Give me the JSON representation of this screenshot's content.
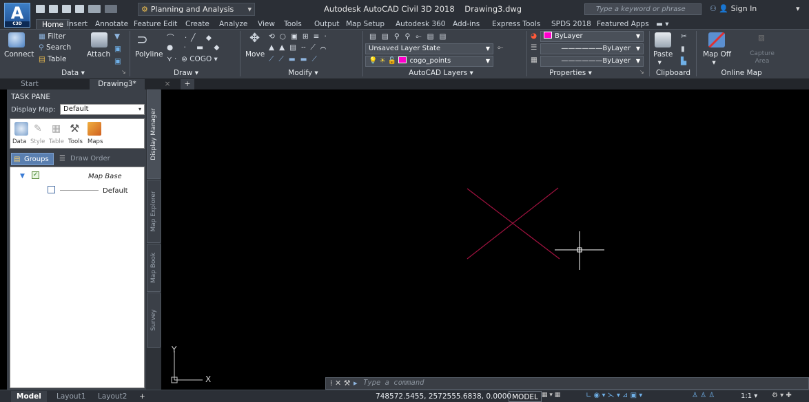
{
  "app": {
    "logo": "A",
    "logo_sub": "C3D",
    "title": "Autodesk AutoCAD Civil 3D 2018",
    "document": "Drawing3.dwg"
  },
  "workspace": {
    "value": "Planning and Analysis"
  },
  "search": {
    "placeholder": "Type a keyword or phrase"
  },
  "account": {
    "sign_in": "Sign In"
  },
  "ribbon_tabs": [
    "Home",
    "Insert",
    "Annotate",
    "Feature Edit",
    "Create",
    "Analyze",
    "View",
    "Tools",
    "Output",
    "Map Setup",
    "Autodesk 360",
    "Add-ins",
    "Express Tools",
    "SPDS 2018",
    "Featured Apps"
  ],
  "panels": {
    "data": {
      "title": "Data",
      "connect": "Connect",
      "filter": "Filter",
      "search": "Search",
      "table": "Table",
      "attach": "Attach"
    },
    "draw": {
      "title": "Draw",
      "polyline": "Polyline",
      "cogo": "COGO"
    },
    "modify": {
      "title": "Modify",
      "move": "Move"
    },
    "layers": {
      "title": "AutoCAD Layers",
      "layer_state": "Unsaved Layer State",
      "current_layer": "cogo_points"
    },
    "properties": {
      "title": "Properties",
      "color": "ByLayer",
      "linetype": "ByLayer",
      "lineweight": "ByLayer"
    },
    "clipboard": {
      "title": "Clipboard",
      "paste": "Paste"
    },
    "online_map": {
      "title": "Online Map",
      "map_off": "Map Off",
      "capture_area": "Capture Area"
    }
  },
  "doc_tabs": [
    "Start",
    "Drawing3*"
  ],
  "task_pane": {
    "title": "TASK PANE",
    "display_map_label": "Display Map:",
    "display_map_value": "Default",
    "tools": [
      "Data",
      "Style",
      "Table",
      "Tools",
      "Maps"
    ],
    "groups": "Groups",
    "draw_order": "Draw Order",
    "tree": {
      "map_base": "Map Base",
      "default": "Default"
    },
    "side_tabs": [
      "Display Manager",
      "Map Explorer",
      "Map Book",
      "Survey"
    ]
  },
  "ucs": {
    "x": "X",
    "y": "Y"
  },
  "command": {
    "placeholder": "Type a command"
  },
  "status": {
    "layout_tabs": [
      "Model",
      "Layout1",
      "Layout2"
    ],
    "coordinates": "748572.5455, 2572555.6838, 0.0000",
    "space": "MODEL",
    "scale": "1:1"
  },
  "colors": {
    "accent": "#3b4048",
    "drawing_line": "#a0123f",
    "swatch": "#ff00cc"
  }
}
